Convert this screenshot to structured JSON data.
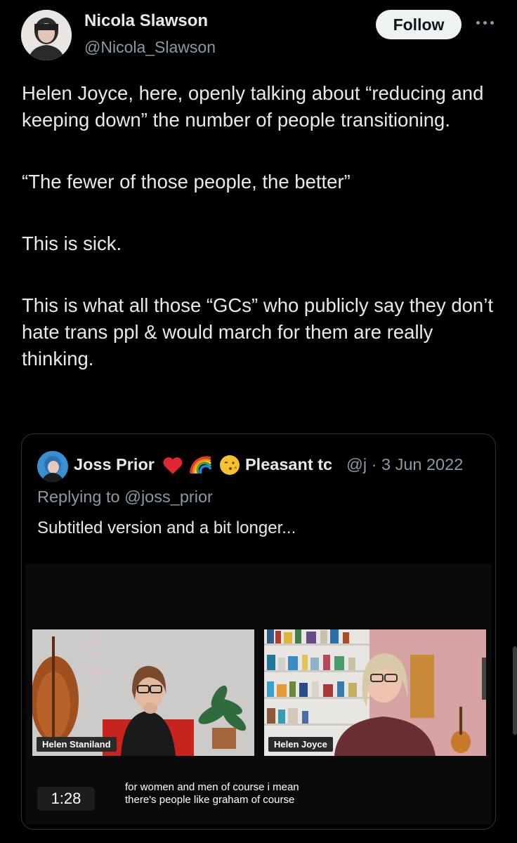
{
  "author": {
    "name": "Nicola Slawson",
    "handle": "@Nicola_Slawson",
    "avatar_icon": "avatar"
  },
  "actions": {
    "follow_label": "Follow",
    "more_icon": "more-horizontal-icon"
  },
  "post": {
    "paragraphs": [
      "Helen Joyce, here, openly talking about “reducing and keeping down” the number of people transitioning.",
      "“The fewer of those people, the better”",
      "This is sick.",
      "This is what all those “GCs” who publicly say they don’t hate trans ppl & would march for them are really thinking."
    ]
  },
  "quoted": {
    "name": "Joss Prior",
    "name_suffix": "Pleasant tc",
    "handle_short": "@j",
    "separator": "·",
    "date": "3 Jun 2022",
    "replying_prefix": "Replying to",
    "replying_handle": "@joss_prior",
    "text": "Subtitled version and a bit longer...",
    "emoji_icons": [
      "red-heart-icon",
      "rainbow-icon",
      "kissing-face-icon"
    ],
    "video": {
      "left_label": "Helen Staniland",
      "right_label": "Helen Joyce",
      "neon_sign": "Wine with Women",
      "duration": "1:28",
      "caption_line1": "for women and men of course i mean",
      "caption_line2": "there's people like graham of course"
    }
  },
  "colors": {
    "background": "#000000",
    "text_primary": "#e7e9ea",
    "text_secondary": "#8b98a5",
    "border": "#2f3336",
    "follow_bg": "#eff3f4"
  }
}
